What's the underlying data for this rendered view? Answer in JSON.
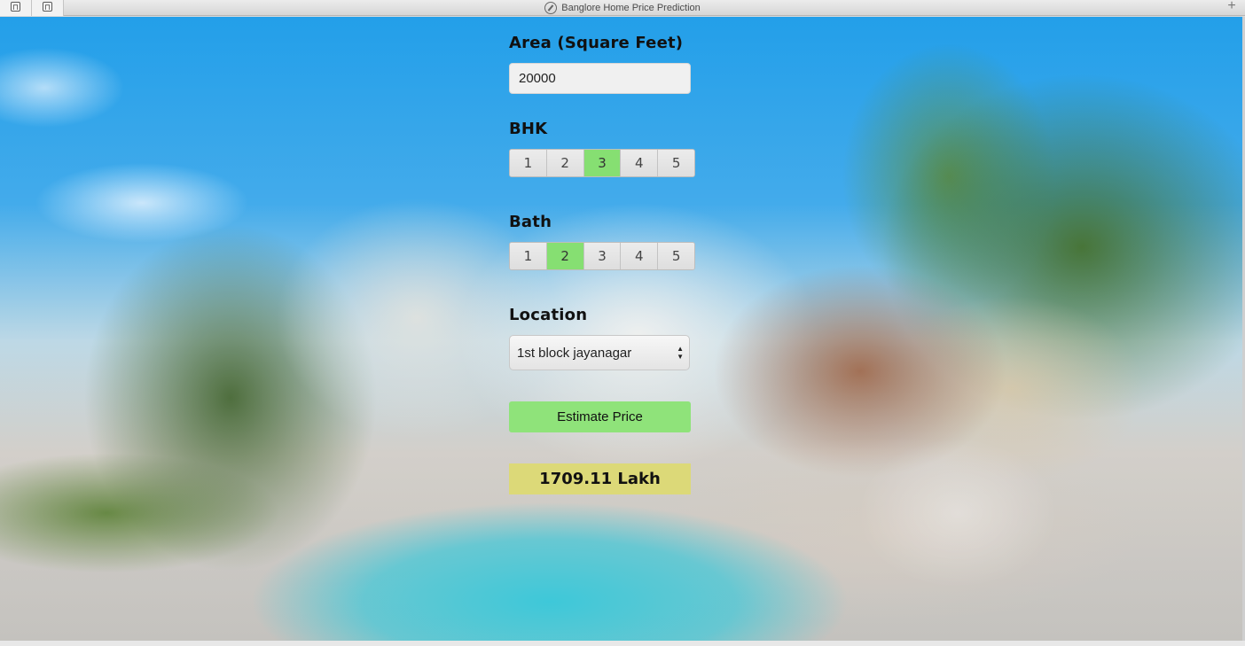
{
  "window": {
    "title": "Banglore Home Price Prediction",
    "tab_glyph": "⊓",
    "new_tab_symbol": "+"
  },
  "form": {
    "area_label": "Area (Square Feet)",
    "area_value": "20000",
    "bhk_label": "BHK",
    "bhk_options": [
      "1",
      "2",
      "3",
      "4",
      "5"
    ],
    "bhk_selected": "3",
    "bath_label": "Bath",
    "bath_options": [
      "1",
      "2",
      "3",
      "4",
      "5"
    ],
    "bath_selected": "2",
    "location_label": "Location",
    "location_value": "1st block jayanagar",
    "estimate_button_label": "Estimate Price",
    "result_text": "1709.11 Lakh"
  },
  "colors": {
    "selected_option": "#86df72",
    "button": "#8fe37a",
    "result_bg": "#dcd978"
  }
}
